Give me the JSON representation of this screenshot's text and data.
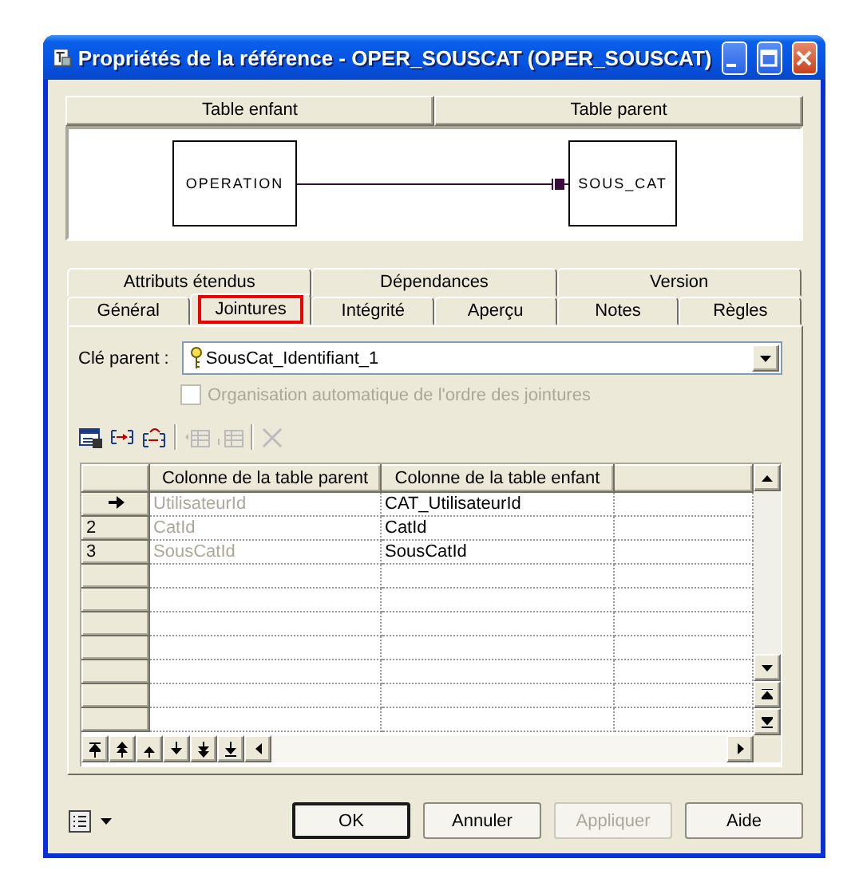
{
  "window": {
    "title": "Propriétés de la référence - OPER_SOUSCAT (OPER_SOUSCAT)"
  },
  "diagram": {
    "headers": [
      "Table enfant",
      "Table parent"
    ],
    "child_table": "OPERATION",
    "parent_table": "SOUS_CAT"
  },
  "tab_rows": [
    {
      "tabs": [
        {
          "label": "Attributs étendus",
          "selected": false
        },
        {
          "label": "Dépendances",
          "selected": false
        },
        {
          "label": "Version",
          "selected": false
        }
      ]
    },
    {
      "tabs": [
        {
          "label": "Général",
          "selected": false
        },
        {
          "label": "Jointures",
          "selected": true
        },
        {
          "label": "Intégrité",
          "selected": false
        },
        {
          "label": "Aperçu",
          "selected": false
        },
        {
          "label": "Notes",
          "selected": false
        },
        {
          "label": "Règles",
          "selected": false
        }
      ]
    }
  ],
  "parent_key": {
    "label": "Clé parent :",
    "value": "SousCat_Identifiant_1"
  },
  "auto_order": {
    "label": "Organisation automatique de l'ordre des jointures",
    "checked": false,
    "disabled": true
  },
  "joins_table": {
    "columns": [
      {
        "label": "Colonne de la table parent",
        "dimmed": true
      },
      {
        "label": "Colonne de la table enfant",
        "dimmed": false
      }
    ],
    "rows": [
      {
        "current": true,
        "cells": [
          "UtilisateurId",
          "CAT_UtilisateurId"
        ]
      },
      {
        "row_header": "2",
        "current": false,
        "cells": [
          "CatId",
          "CatId"
        ]
      },
      {
        "row_header": "3",
        "current": false,
        "cells": [
          "SousCatId",
          "SousCatId"
        ]
      }
    ]
  },
  "buttons": [
    {
      "label": "OK",
      "default": true,
      "disabled": false
    },
    {
      "label": "Annuler",
      "default": false,
      "disabled": false
    },
    {
      "label": "Appliquer",
      "default": false,
      "disabled": true
    },
    {
      "label": "Aide",
      "default": false,
      "disabled": false
    }
  ]
}
